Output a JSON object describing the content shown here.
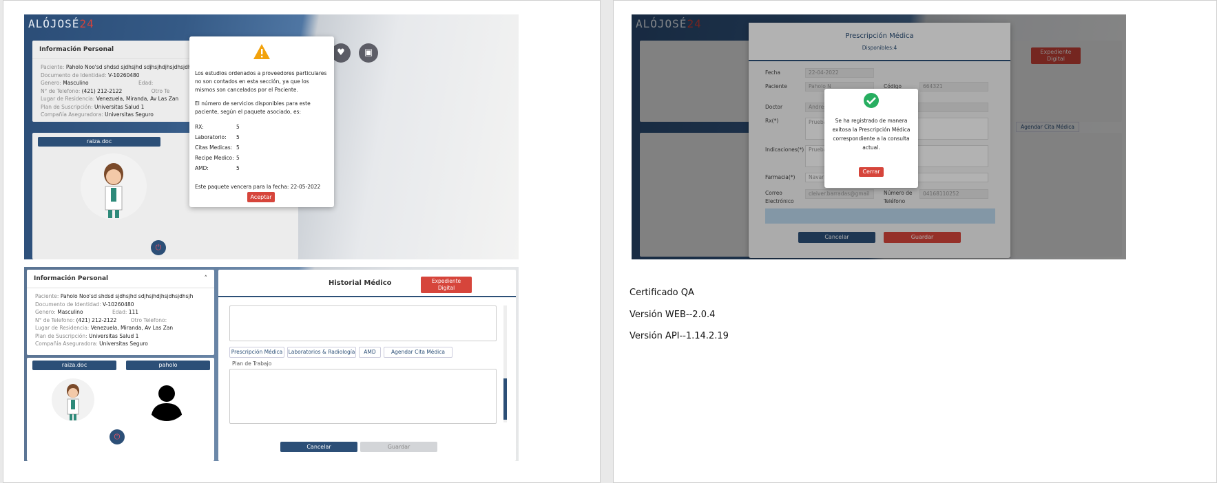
{
  "brand": {
    "name": "ALÓJOSÉ",
    "suffix": "24"
  },
  "shot1": {
    "card_title": "Información Personal",
    "patient_label": "Paciente:",
    "patient": "Paholo Noo'sd shdsd sjdhsjhd sdjhsjhdjhsjdhsjdhsjh",
    "doc_label": "Documento de Identidad:",
    "doc": "V-10260480",
    "gender_label": "Genero:",
    "gender": "Masculino",
    "age_label": "Edad:",
    "phone_label": "N° de Telefono:",
    "phone": "(421) 212-2122",
    "other_phone_label": "Otro Te",
    "residence_label": "Lugar de Residencia:",
    "residence": "Venezuela, Miranda, Av Las Zan",
    "plan_label": "Plan de Suscripción:",
    "plan": "Universitas Salud 1",
    "insurer_label": "Compañía Aseguradora:",
    "insurer": "Universitas Seguro",
    "doctor_btn": "raiza.doc",
    "modal_p1": "Los estudios ordenados a proveedores particulares no son contados en esta sección, ya que los mismos son cancelados por el Paciente.",
    "modal_p2": "El número de servicios disponibles para este paciente, según el paquete asociado, es:",
    "services": [
      {
        "name": "RX:",
        "value": "5"
      },
      {
        "name": "Laboratorio:",
        "value": "5"
      },
      {
        "name": "Citas Medicas:",
        "value": "5"
      },
      {
        "name": "Recipe Medico:",
        "value": "5"
      },
      {
        "name": "AMD:",
        "value": "5"
      }
    ],
    "modal_expiry": "Este paquete vencera para la fecha: 22-05-2022",
    "accept_btn": "Aceptar"
  },
  "shot2": {
    "card_title": "Información Personal",
    "patient": "Paholo Noo'sd shdsd sjdhsjhd sdjhsjhdjhsjdhsjdhsjh",
    "doc": "V-10260480",
    "gender": "Masculino",
    "age_label": "Edad:",
    "age": "111",
    "phone": "(421) 212-2122",
    "other_phone_label": "Otro Telefono:",
    "residence": "Venezuela, Miranda, Av Las Zan",
    "plan": "Universitas Salud 1",
    "insurer": "Universitas Seguro",
    "doctor_btn": "raiza.doc",
    "patient_btn": "paholo",
    "history_title": "Historial Médico",
    "expediente_btn": "Expediente Digital",
    "tabs": [
      "Prescripción Médica",
      "Laboratorios & Radiología",
      "AMD",
      "Agendar Cita Médica"
    ],
    "plan_label": "Plan de Trabajo",
    "cancel_btn": "Cancelar",
    "save_btn": "Guardar"
  },
  "shot3": {
    "rx_title": "Prescripción Médica",
    "rx_available": "Disponibles:4",
    "fecha_label": "Fecha",
    "fecha": "22-04-2022",
    "paciente_label": "Paciente",
    "paciente": "Paholo N",
    "codigo_label": "Código",
    "codigo": "664321",
    "doctor_label": "Doctor",
    "doctor": "Andres",
    "rx_label": "Rx(*)",
    "rx_value": "Prueba",
    "indicaciones_label": "Indicaciones(*)",
    "indicaciones_value": "Prueba",
    "farmacia_label": "Farmacia(*)",
    "farmacia": "Navarr",
    "correo_label": "Correo Electrónico",
    "correo": "cleiver.barradas@gmail",
    "telefono_label": "Número de Teléfono",
    "telefono": "04168110252",
    "success_msg": "Se ha registrado de manera exitosa la Prescripción Médica correspondiente a la consulta actual.",
    "close_btn": "Cerrar",
    "cancel_btn": "Cancelar",
    "save_btn": "Guardar",
    "expediente_btn": "Expediente Digital",
    "agendar": "Agendar Cita Médica",
    "guardar_bg": "Guardar"
  },
  "doc": {
    "line1": "Certificado QA",
    "line2": "Versión WEB--2.0.4",
    "line3": "Versión API--1.14.2.19"
  },
  "colors": {
    "primary": "#2c4f77",
    "accent": "#d6453b",
    "success": "#27ae60"
  }
}
